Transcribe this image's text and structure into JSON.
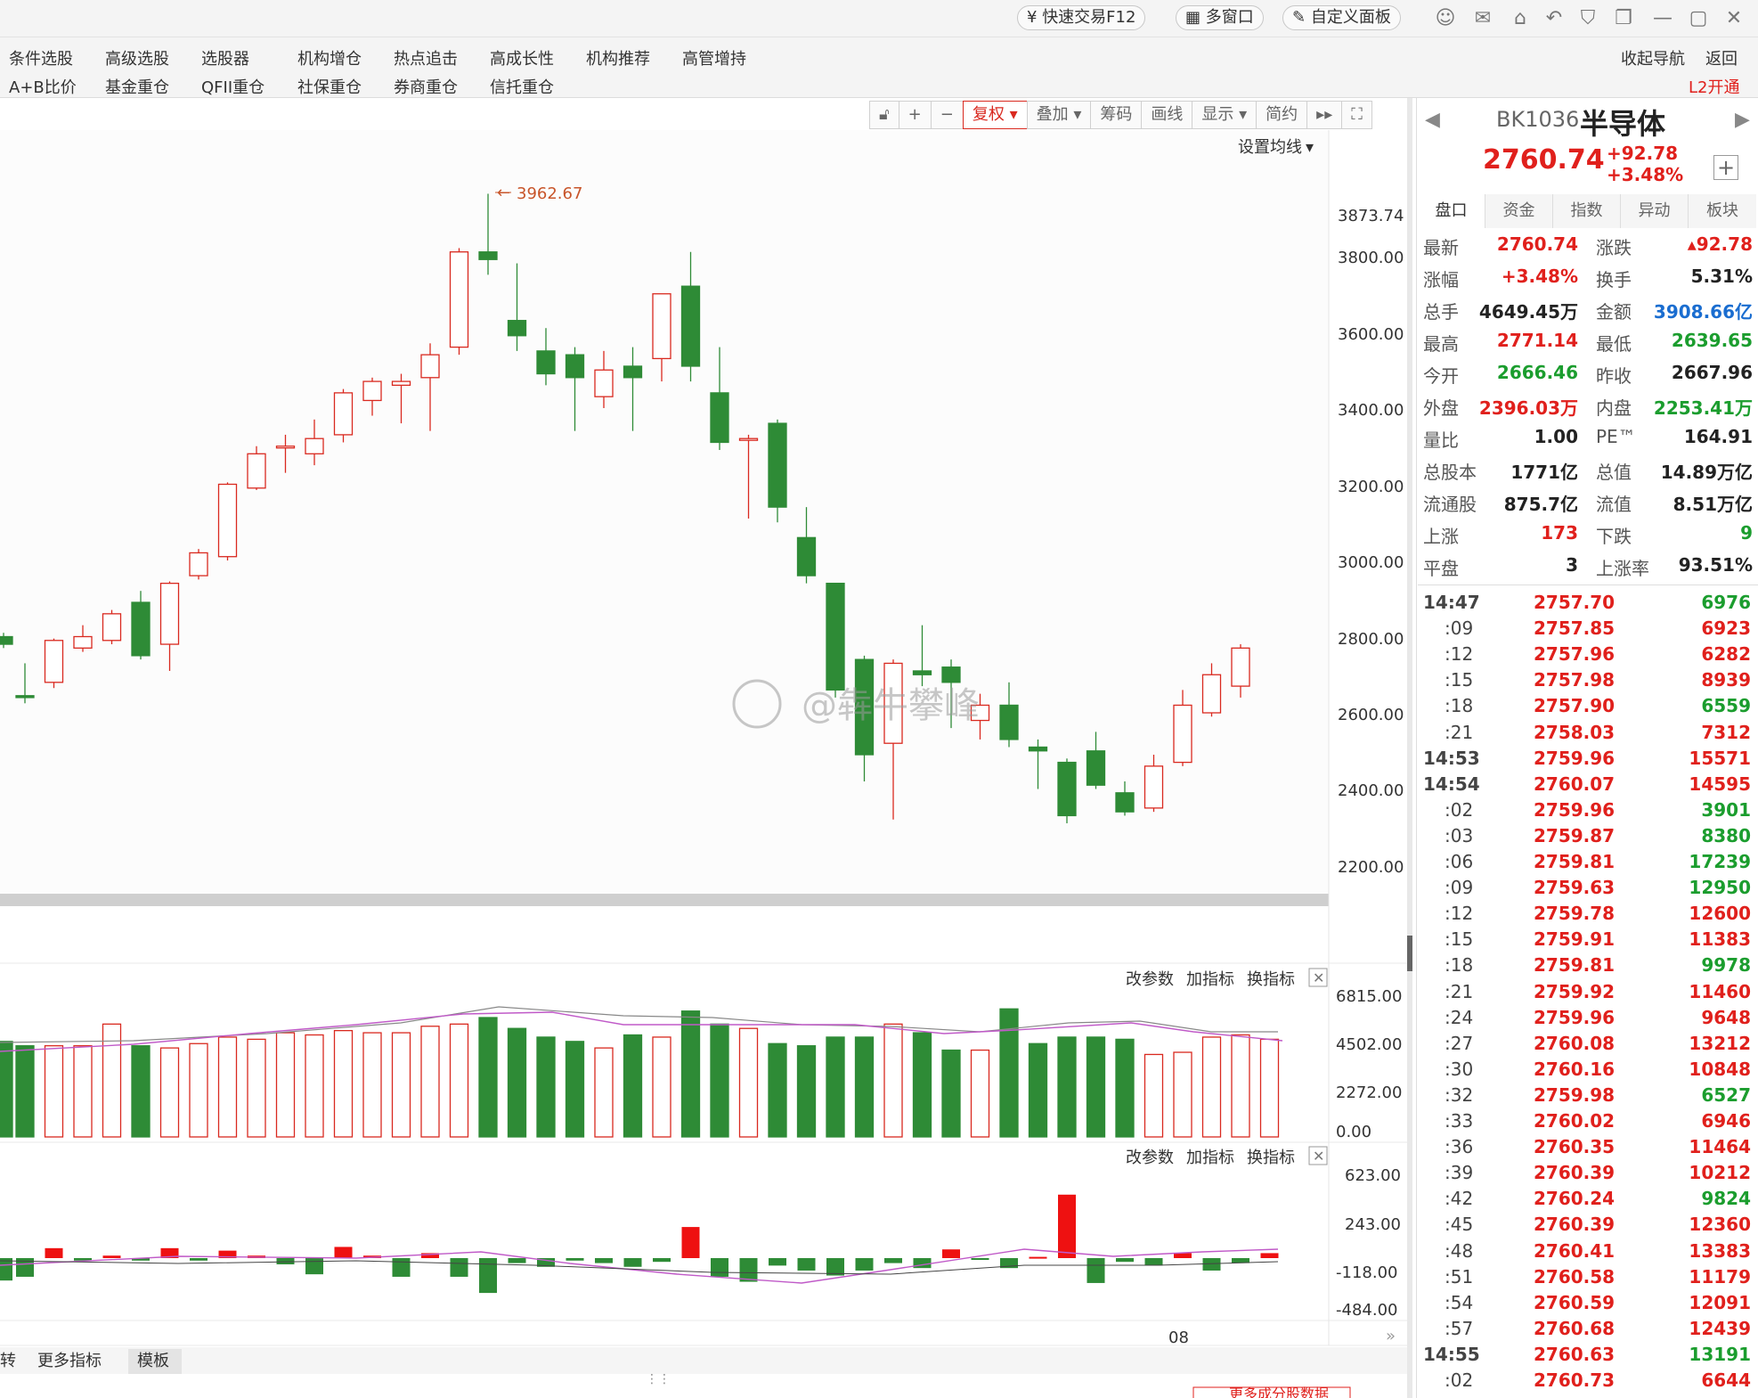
{
  "topbar": {
    "quick_trade": "快速交易F12",
    "multi_window": "多窗口",
    "custom_panel": "自定义面板"
  },
  "menu": {
    "row1": [
      "条件选股",
      "高级选股",
      "选股器",
      "机构增仓",
      "热点追击",
      "高成长性",
      "机构推荐",
      "高管增持"
    ],
    "row2": [
      "A+B比价",
      "基金重仓",
      "QFII重仓",
      "社保重仓",
      "券商重仓",
      "信托重仓"
    ],
    "right_nav": "收起导航",
    "right_back": "返回",
    "right_l2": "L2开通"
  },
  "chart_toolbar": {
    "fuquan": "复权",
    "overlay": "叠加",
    "chips": "筹码",
    "draw": "画线",
    "display": "显示",
    "simple": "简约"
  },
  "main_chart": {
    "set_ma": "设置均线",
    "high_marker": "3962.67",
    "price_axis": [
      "3873.74",
      "3800.00",
      "3600.00",
      "3400.00",
      "3200.00",
      "3000.00",
      "2800.00",
      "2600.00",
      "2400.00",
      "2200.00"
    ]
  },
  "vol_panel": {
    "btn_params": "改参数",
    "btn_add": "加指标",
    "btn_switch": "换指标",
    "axis": [
      "6815.00",
      "4502.00",
      "2272.00",
      "0.00"
    ]
  },
  "ind_panel": {
    "btn_params": "改参数",
    "btn_add": "加指标",
    "btn_switch": "换指标",
    "axis": [
      "623.00",
      "243.00",
      "-118.00",
      "-484.00"
    ]
  },
  "x_axis_label": "08",
  "bottom_tabs": {
    "left_cut": "转",
    "more": "更多指标",
    "template": "模板"
  },
  "bottom_btn": "更多成分股数据",
  "watermark": "@犇牛攀峰",
  "chart_data": {
    "type": "candlestick",
    "y_range": [
      2200,
      3900
    ],
    "candles": [
      {
        "o": 2800,
        "c": 2780,
        "h": 2810,
        "l": 2770
      },
      {
        "o": 2645,
        "c": 2640,
        "h": 2730,
        "l": 2625
      },
      {
        "o": 2680,
        "c": 2790,
        "h": 2795,
        "l": 2665
      },
      {
        "o": 2770,
        "c": 2800,
        "h": 2830,
        "l": 2760
      },
      {
        "o": 2790,
        "c": 2860,
        "h": 2870,
        "l": 2780
      },
      {
        "o": 2890,
        "c": 2750,
        "h": 2920,
        "l": 2740
      },
      {
        "o": 2780,
        "c": 2940,
        "h": 2945,
        "l": 2710
      },
      {
        "o": 2960,
        "c": 3020,
        "h": 3030,
        "l": 2950
      },
      {
        "o": 3010,
        "c": 3200,
        "h": 3205,
        "l": 3000
      },
      {
        "o": 3190,
        "c": 3280,
        "h": 3300,
        "l": 3185
      },
      {
        "o": 3300,
        "c": 3300,
        "h": 3330,
        "l": 3230
      },
      {
        "o": 3280,
        "c": 3320,
        "h": 3370,
        "l": 3250
      },
      {
        "o": 3330,
        "c": 3440,
        "h": 3450,
        "l": 3310
      },
      {
        "o": 3420,
        "c": 3470,
        "h": 3480,
        "l": 3380
      },
      {
        "o": 3460,
        "c": 3470,
        "h": 3490,
        "l": 3360
      },
      {
        "o": 3480,
        "c": 3540,
        "h": 3570,
        "l": 3340
      },
      {
        "o": 3560,
        "c": 3810,
        "h": 3820,
        "l": 3540
      },
      {
        "o": 3810,
        "c": 3790,
        "h": 3962.67,
        "l": 3750
      },
      {
        "o": 3630,
        "c": 3590,
        "h": 3780,
        "l": 3550
      },
      {
        "o": 3550,
        "c": 3490,
        "h": 3610,
        "l": 3460
      },
      {
        "o": 3540,
        "c": 3480,
        "h": 3560,
        "l": 3340
      },
      {
        "o": 3430,
        "c": 3500,
        "h": 3550,
        "l": 3400
      },
      {
        "o": 3510,
        "c": 3480,
        "h": 3560,
        "l": 3340
      },
      {
        "o": 3530,
        "c": 3700,
        "h": 3700,
        "l": 3470
      },
      {
        "o": 3720,
        "c": 3510,
        "h": 3810,
        "l": 3470
      },
      {
        "o": 3440,
        "c": 3310,
        "h": 3560,
        "l": 3290
      },
      {
        "o": 3320,
        "c": 3320,
        "h": 3330,
        "l": 3110
      },
      {
        "o": 3360,
        "c": 3140,
        "h": 3370,
        "l": 3100
      },
      {
        "o": 3060,
        "c": 2960,
        "h": 3140,
        "l": 2940
      },
      {
        "o": 2940,
        "c": 2660,
        "h": 2940,
        "l": 2640
      },
      {
        "o": 2740,
        "c": 2490,
        "h": 2750,
        "l": 2420
      },
      {
        "o": 2520,
        "c": 2730,
        "h": 2740,
        "l": 2320
      },
      {
        "o": 2710,
        "c": 2700,
        "h": 2830,
        "l": 2670
      },
      {
        "o": 2720,
        "c": 2680,
        "h": 2740,
        "l": 2560
      },
      {
        "o": 2580,
        "c": 2620,
        "h": 2650,
        "l": 2530
      },
      {
        "o": 2620,
        "c": 2530,
        "h": 2680,
        "l": 2510
      },
      {
        "o": 2510,
        "c": 2500,
        "h": 2530,
        "l": 2400
      },
      {
        "o": 2470,
        "c": 2330,
        "h": 2480,
        "l": 2310
      },
      {
        "o": 2500,
        "c": 2410,
        "h": 2550,
        "l": 2400
      },
      {
        "o": 2390,
        "c": 2340,
        "h": 2420,
        "l": 2330
      },
      {
        "o": 2350,
        "c": 2460,
        "h": 2490,
        "l": 2340
      },
      {
        "o": 2470,
        "c": 2620,
        "h": 2660,
        "l": 2460
      },
      {
        "o": 2600,
        "c": 2700,
        "h": 2730,
        "l": 2590
      },
      {
        "o": 2670,
        "c": 2770,
        "h": 2780,
        "l": 2640
      }
    ],
    "volume": [
      4400,
      4200,
      4200,
      4200,
      5200,
      4200,
      4100,
      4300,
      4600,
      4500,
      4800,
      4700,
      4900,
      4800,
      4800,
      5100,
      5200,
      5500,
      5000,
      4600,
      4400,
      4100,
      4700,
      4600,
      5800,
      5200,
      5000,
      4300,
      4200,
      4600,
      4600,
      5200,
      4800,
      4000,
      4000,
      5900,
      4300,
      4600,
      4600,
      4500,
      3800,
      3900,
      4600,
      4700,
      4500
    ],
    "indicator": [
      -180,
      -150,
      80,
      -20,
      20,
      -20,
      80,
      -20,
      60,
      20,
      -50,
      -130,
      90,
      20,
      -150,
      40,
      -150,
      -280,
      -40,
      -70,
      -20,
      -40,
      -70,
      -30,
      250,
      -150,
      -190,
      -60,
      -100,
      -140,
      -100,
      -40,
      -80,
      70,
      -10,
      -80,
      10,
      510,
      -200,
      -30,
      -60,
      40,
      -100,
      -40,
      40,
      40,
      -10,
      40,
      -30,
      40,
      10,
      40,
      40,
      50
    ]
  },
  "quote": {
    "code": "BK1036",
    "name": "半导体",
    "price": "2760.74",
    "change": "+92.78",
    "change_pct": "+3.48%",
    "tabs": [
      "盘口",
      "资金",
      "指数",
      "异动",
      "板块"
    ],
    "rows": [
      {
        "l1": "最新",
        "v1": "2760.74",
        "c1": "red",
        "l2": "涨跌",
        "v2": "▴92.78",
        "c2": "red"
      },
      {
        "l1": "涨幅",
        "v1": "+3.48%",
        "c1": "red",
        "l2": "换手",
        "v2": "5.31%",
        "c2": "dark"
      },
      {
        "l1": "总手",
        "v1": "4649.45万",
        "c1": "dark",
        "l2": "金额",
        "v2": "3908.66亿",
        "c2": "blue"
      },
      {
        "l1": "最高",
        "v1": "2771.14",
        "c1": "red",
        "l2": "最低",
        "v2": "2639.65",
        "c2": "green"
      },
      {
        "l1": "今开",
        "v1": "2666.46",
        "c1": "green",
        "l2": "昨收",
        "v2": "2667.96",
        "c2": "dark"
      },
      {
        "l1": "外盘",
        "v1": "2396.03万",
        "c1": "red",
        "l2": "内盘",
        "v2": "2253.41万",
        "c2": "green"
      },
      {
        "l1": "量比",
        "v1": "1.00",
        "c1": "dark",
        "l2": "PE™",
        "v2": "164.91",
        "c2": "dark"
      },
      {
        "l1": "总股本",
        "v1": "1771亿",
        "c1": "dark",
        "l2": "总值",
        "v2": "14.89万亿",
        "c2": "dark"
      },
      {
        "l1": "流通股",
        "v1": "875.7亿",
        "c1": "dark",
        "l2": "流值",
        "v2": "8.51万亿",
        "c2": "dark"
      },
      {
        "l1": "上涨",
        "v1": "173",
        "c1": "red",
        "l2": "下跌",
        "v2": "9",
        "c2": "green"
      },
      {
        "l1": "平盘",
        "v1": "3",
        "c1": "dark",
        "l2": "上涨率",
        "v2": "93.51%",
        "c2": "dark"
      }
    ]
  },
  "ticks": [
    {
      "t": "14:47",
      "p": "2757.70",
      "v": "6976",
      "vc": "green"
    },
    {
      "t": ":09",
      "p": "2757.85",
      "v": "6923",
      "vc": "red"
    },
    {
      "t": ":12",
      "p": "2757.96",
      "v": "6282",
      "vc": "red"
    },
    {
      "t": ":15",
      "p": "2757.98",
      "v": "8939",
      "vc": "red"
    },
    {
      "t": ":18",
      "p": "2757.90",
      "v": "6559",
      "vc": "green"
    },
    {
      "t": ":21",
      "p": "2758.03",
      "v": "7312",
      "vc": "red"
    },
    {
      "t": "14:53",
      "p": "2759.96",
      "v": "15571",
      "vc": "red"
    },
    {
      "t": "14:54",
      "p": "2760.07",
      "v": "14595",
      "vc": "red"
    },
    {
      "t": ":02",
      "p": "2759.96",
      "v": "3901",
      "vc": "green"
    },
    {
      "t": ":03",
      "p": "2759.87",
      "v": "8380",
      "vc": "green"
    },
    {
      "t": ":06",
      "p": "2759.81",
      "v": "17239",
      "vc": "green"
    },
    {
      "t": ":09",
      "p": "2759.63",
      "v": "12950",
      "vc": "green"
    },
    {
      "t": ":12",
      "p": "2759.78",
      "v": "12600",
      "vc": "red"
    },
    {
      "t": ":15",
      "p": "2759.91",
      "v": "11383",
      "vc": "red"
    },
    {
      "t": ":18",
      "p": "2759.81",
      "v": "9978",
      "vc": "green"
    },
    {
      "t": ":21",
      "p": "2759.92",
      "v": "11460",
      "vc": "red"
    },
    {
      "t": ":24",
      "p": "2759.96",
      "v": "9648",
      "vc": "red"
    },
    {
      "t": ":27",
      "p": "2760.08",
      "v": "13212",
      "vc": "red"
    },
    {
      "t": ":30",
      "p": "2760.16",
      "v": "10848",
      "vc": "red"
    },
    {
      "t": ":32",
      "p": "2759.98",
      "v": "6527",
      "vc": "green"
    },
    {
      "t": ":33",
      "p": "2760.02",
      "v": "6946",
      "vc": "red"
    },
    {
      "t": ":36",
      "p": "2760.35",
      "v": "11464",
      "vc": "red"
    },
    {
      "t": ":39",
      "p": "2760.39",
      "v": "10212",
      "vc": "red"
    },
    {
      "t": ":42",
      "p": "2760.24",
      "v": "9824",
      "vc": "green"
    },
    {
      "t": ":45",
      "p": "2760.39",
      "v": "12360",
      "vc": "red"
    },
    {
      "t": ":48",
      "p": "2760.41",
      "v": "13383",
      "vc": "red"
    },
    {
      "t": ":51",
      "p": "2760.58",
      "v": "11179",
      "vc": "red"
    },
    {
      "t": ":54",
      "p": "2760.59",
      "v": "12091",
      "vc": "red"
    },
    {
      "t": ":57",
      "p": "2760.68",
      "v": "12439",
      "vc": "red"
    },
    {
      "t": "14:55",
      "p": "2760.63",
      "v": "13191",
      "vc": "green"
    },
    {
      "t": ":02",
      "p": "2760.73",
      "v": "6644",
      "vc": "red"
    }
  ]
}
